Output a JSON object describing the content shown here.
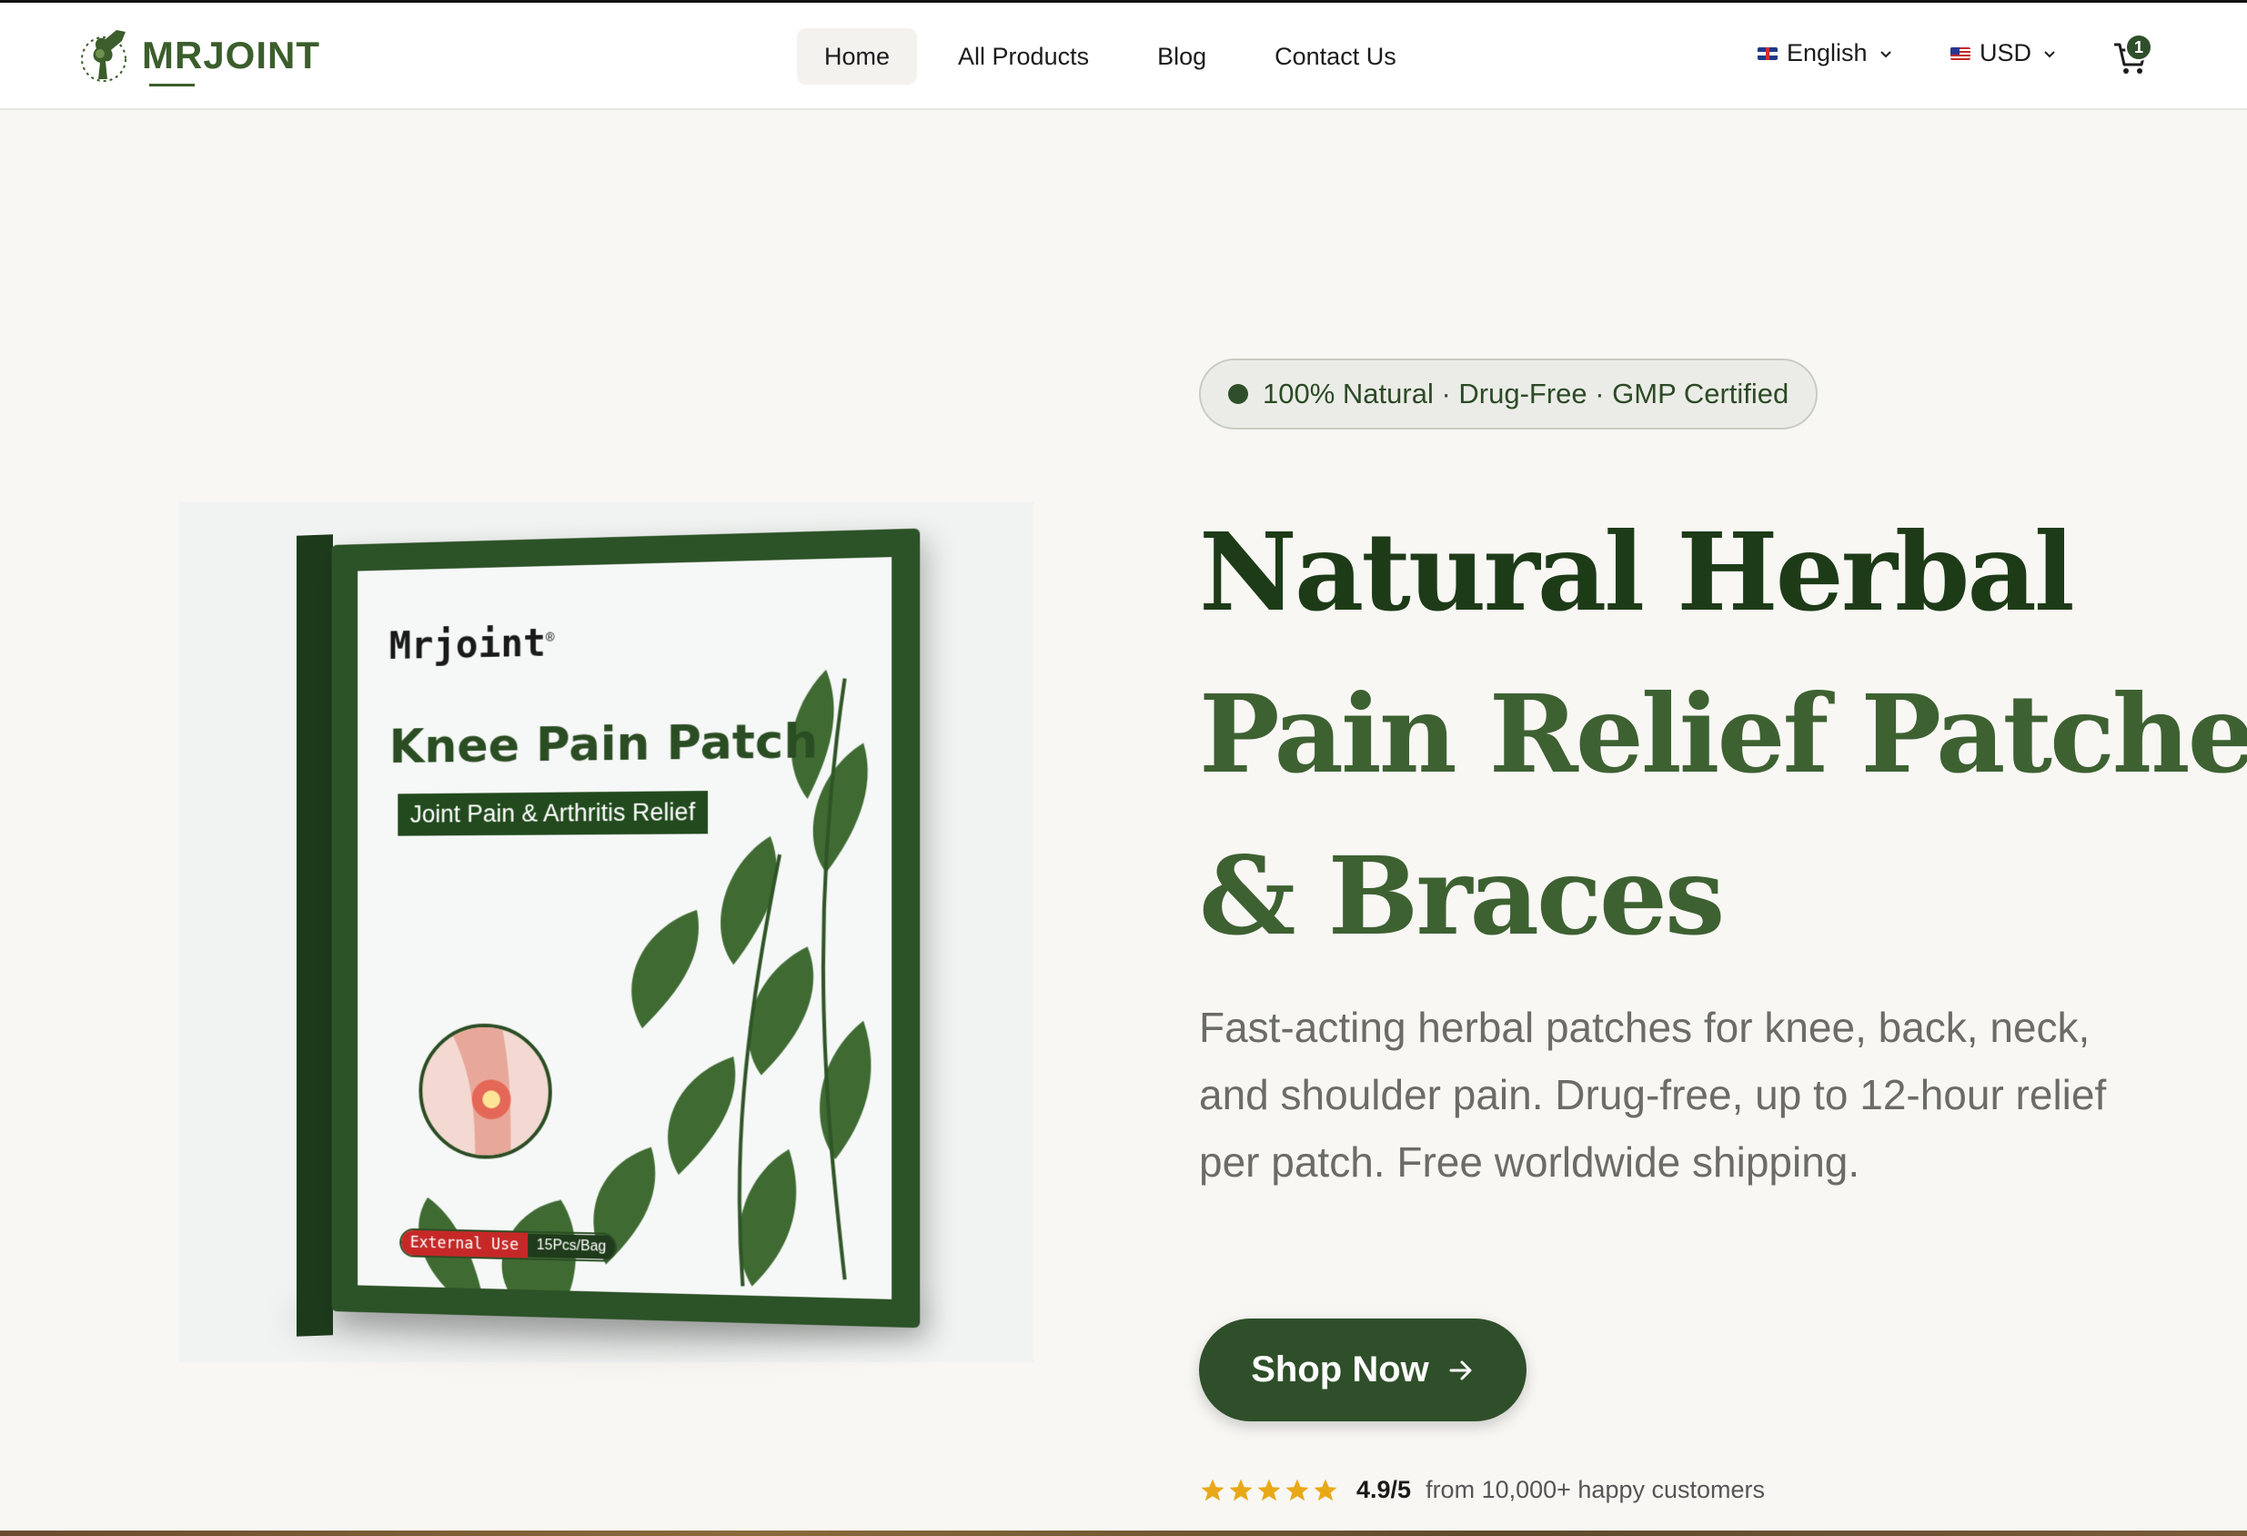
{
  "header": {
    "logo_text": "MRJOINT",
    "nav": [
      {
        "label": "Home",
        "active": true
      },
      {
        "label": "All Products",
        "active": false
      },
      {
        "label": "Blog",
        "active": false
      },
      {
        "label": "Contact Us",
        "active": false
      }
    ],
    "language": {
      "label": "English",
      "flag": "uk-flag-icon"
    },
    "currency": {
      "label": "USD",
      "flag": "us-flag-icon"
    },
    "cart_count": "1"
  },
  "product_image": {
    "brand": "Mrjoint",
    "registered": "®",
    "title": "Knee Pain Patch",
    "subtitle": "Joint Pain & Arthritis Relief",
    "badge_use": "External Use",
    "badge_count": "15Pcs/Bag"
  },
  "hero": {
    "pill": "100% Natural · Drug-Free · GMP Certified",
    "headline_line1": "Natural Herbal",
    "headline_line2": "Pain Relief Patches",
    "headline_line3": "& Braces",
    "description": "Fast-acting herbal patches for knee, back, neck, and shoulder pain. Drug-free, up to 12-hour relief per patch. Free worldwide shipping.",
    "cta": "Shop Now",
    "rating_score": "4.9/5",
    "rating_text": "from 10,000+ happy customers",
    "stars": 5
  },
  "colors": {
    "brand_green": "#2f4f2a",
    "headline_dark": "#1e3b18",
    "headline_light": "#3e6132",
    "star": "#e9a817",
    "background": "#f8f7f4"
  }
}
